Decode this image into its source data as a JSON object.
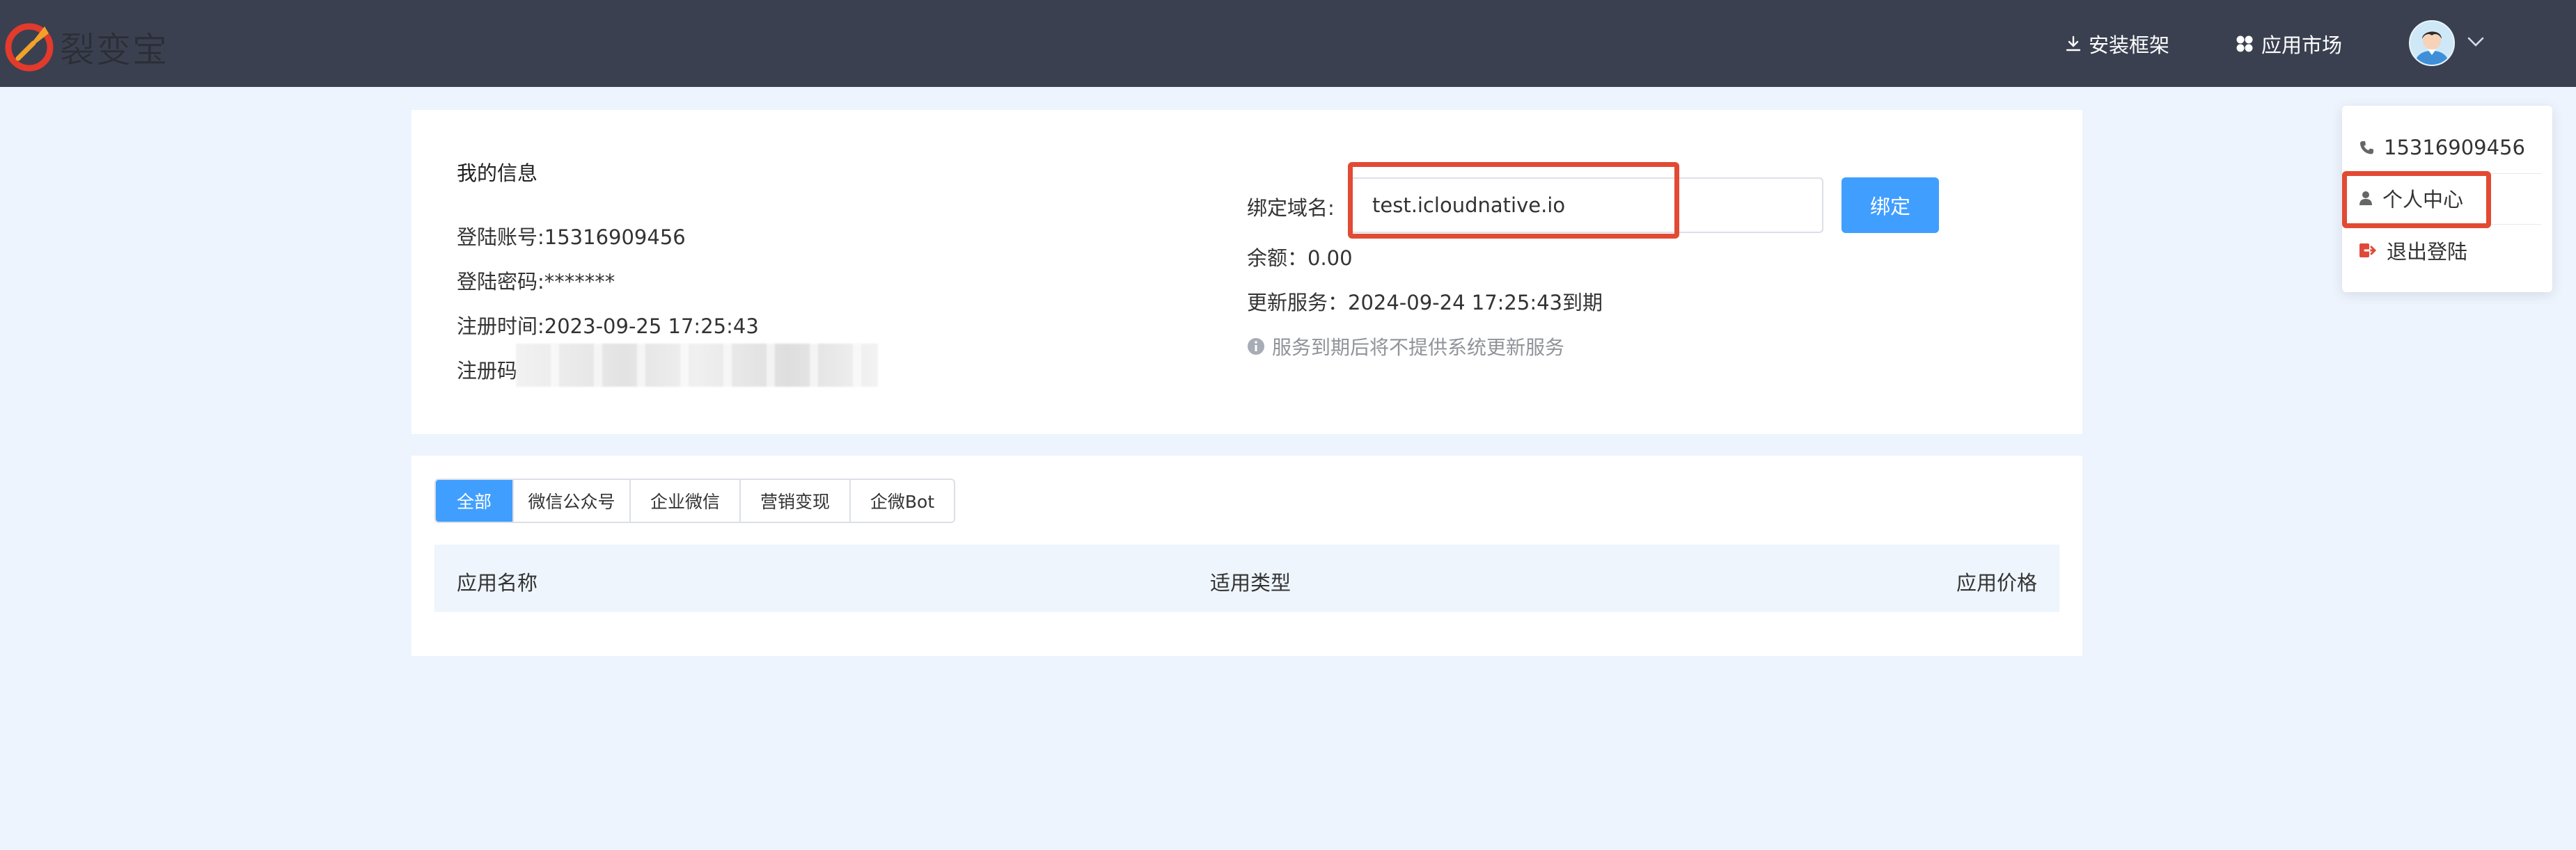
{
  "header": {
    "logo_text": "裂变宝",
    "install_label": "安装框架",
    "market_label": "应用市场"
  },
  "dropdown": {
    "phone": "15316909456",
    "profile_label": "个人中心",
    "logout_label": "退出登陆"
  },
  "info": {
    "title": "我的信息",
    "account": "登陆账号:15316909456",
    "password": "登陆密码:*******",
    "register_time": "注册时间:2023-09-25 17:25:43",
    "register_code_label": "注册码",
    "domain_label": "绑定域名:",
    "domain_value": "test.icloudnative.io",
    "bind_button": "绑定",
    "balance": "余额：0.00",
    "service_update": "更新服务：2024-09-24 17:25:43到期",
    "service_tip": "服务到期后将不提供系统更新服务"
  },
  "apps": {
    "tabs": [
      "全部",
      "微信公众号",
      "企业微信",
      "营销变现",
      "企微Bot"
    ],
    "active_tab": 0,
    "columns": [
      "应用名称",
      "适用类型",
      "应用价格"
    ]
  },
  "colors": {
    "header_bg": "#3a4050",
    "page_bg": "#edf4fd",
    "primary": "#409eff",
    "highlight": "#e24a33",
    "logout_icon": "#e0493a"
  },
  "icons": {
    "install": "download-icon",
    "market": "grid-four-dots-icon",
    "phone": "phone-icon",
    "profile": "user-icon",
    "logout": "logout-icon",
    "tip": "info-circle-icon"
  }
}
